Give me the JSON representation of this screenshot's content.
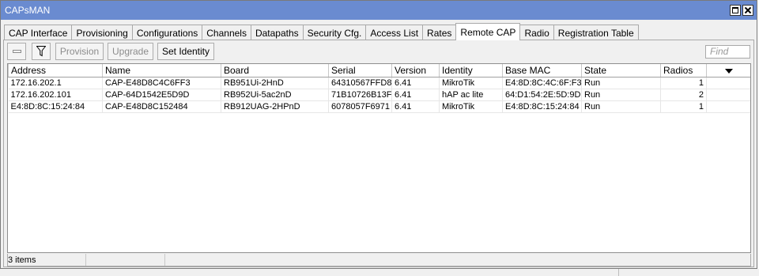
{
  "window": {
    "title": "CAPsMAN"
  },
  "tabs": [
    {
      "label": "CAP Interface"
    },
    {
      "label": "Provisioning"
    },
    {
      "label": "Configurations"
    },
    {
      "label": "Channels"
    },
    {
      "label": "Datapaths"
    },
    {
      "label": "Security Cfg."
    },
    {
      "label": "Access List"
    },
    {
      "label": "Rates"
    },
    {
      "label": "Remote CAP"
    },
    {
      "label": "Radio"
    },
    {
      "label": "Registration Table"
    }
  ],
  "active_tab": "Remote CAP",
  "toolbar": {
    "remove_icon": "minus-icon",
    "filter_icon": "filter-icon",
    "provision_label": "Provision",
    "upgrade_label": "Upgrade",
    "set_identity_label": "Set Identity",
    "find_placeholder": "Find"
  },
  "table": {
    "columns": [
      "Address",
      "Name",
      "Board",
      "Serial",
      "Version",
      "Identity",
      "Base MAC",
      "State",
      "Radios"
    ],
    "rows": [
      {
        "address": "172.16.202.1",
        "name": "CAP-E48D8C4C6FF3",
        "board": "RB951Ui-2HnD",
        "serial": "64310567FFD8",
        "version": "6.41",
        "identity": "MikroTik",
        "base_mac": "E4:8D:8C:4C:6F:F3",
        "state": "Run",
        "radios": "1"
      },
      {
        "address": "172.16.202.101",
        "name": "CAP-64D1542E5D9D",
        "board": "RB952Ui-5ac2nD",
        "serial": "71B10726B13F",
        "version": "6.41",
        "identity": "hAP ac lite",
        "base_mac": "64:D1:54:2E:5D:9D",
        "state": "Run",
        "radios": "2"
      },
      {
        "address": "E4:8D:8C:15:24:84",
        "name": "CAP-E48D8C152484",
        "board": "RB912UAG-2HPnD",
        "serial": "6078057F6971",
        "version": "6.41",
        "identity": "MikroTik",
        "base_mac": "E4:8D:8C:15:24:84",
        "state": "Run",
        "radios": "1"
      }
    ]
  },
  "status": {
    "items_count": "3 items"
  },
  "colors": {
    "titlebar": "#6a8bd0",
    "window_bg": "#f0f0f0"
  }
}
